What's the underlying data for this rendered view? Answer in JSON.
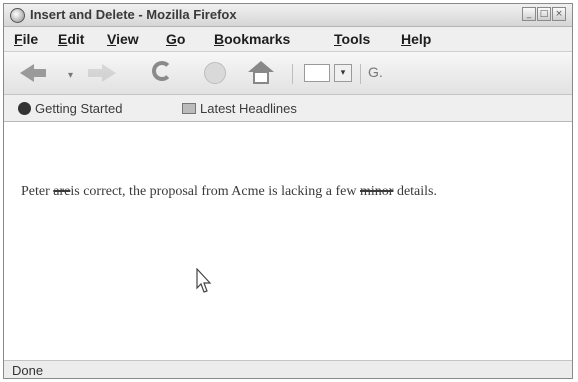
{
  "window": {
    "title": "Insert and Delete - Mozilla Firefox"
  },
  "menu": [
    {
      "label": "File",
      "underline": "F",
      "rest": "ile"
    },
    {
      "label": "Edit",
      "underline": "E",
      "rest": "dit"
    },
    {
      "label": "View",
      "underline": "V",
      "rest": "iew"
    },
    {
      "label": "Go",
      "underline": "G",
      "rest": "o"
    },
    {
      "label": "Bookmarks",
      "underline": "B",
      "rest": "ookmarks"
    },
    {
      "label": "Tools",
      "underline": "T",
      "rest": "ools"
    },
    {
      "label": "Help",
      "underline": "H",
      "rest": "elp"
    }
  ],
  "navigation": {
    "icons": [
      "back-arrow-icon",
      "forward-arrow-icon",
      "reload-icon",
      "stop-icon",
      "home-icon",
      "search-engine-icon"
    ],
    "search_engine_glyph": "G."
  },
  "bookmarks": [
    {
      "label": "Getting Started",
      "icon": "getting-started-icon"
    },
    {
      "label": "Latest Headlines",
      "icon": "rss-icon"
    }
  ],
  "content": {
    "segment_1": "Peter ",
    "deleted_1": "are",
    "segment_2": "is correct, the proposal from Acme is lacking a few ",
    "deleted_2": "minor",
    "segment_3": " details."
  },
  "status": {
    "text": "Done"
  }
}
